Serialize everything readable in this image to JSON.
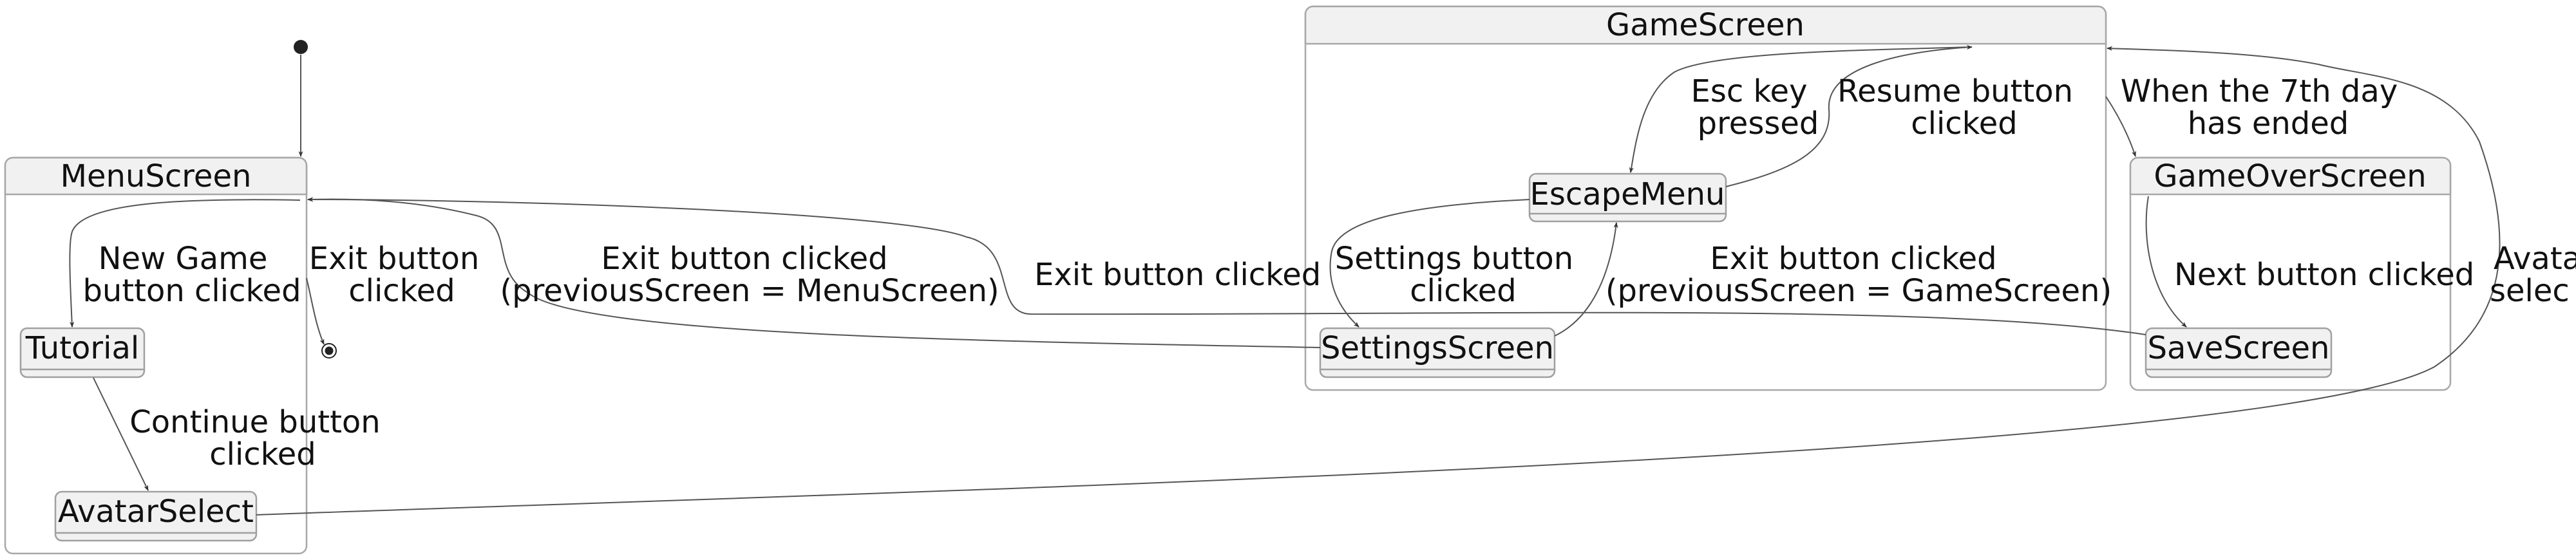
{
  "diagram": {
    "type": "state-diagram",
    "composite_states": {
      "menu": "MenuScreen",
      "game": "GameScreen",
      "gameover": "GameOverScreen"
    },
    "states": {
      "tutorial": "Tutorial",
      "avatar_select": "AvatarSelect",
      "escape_menu": "EscapeMenu",
      "settings": "SettingsScreen",
      "save": "SaveScreen"
    },
    "transitions": {
      "new_game": [
        "New Game",
        "button clicked"
      ],
      "exit_menu": [
        "Exit button",
        "clicked"
      ],
      "continue": [
        "Continue button",
        "clicked"
      ],
      "exit_settings_menu": [
        "Exit button clicked",
        "(previousScreen = MenuScreen)"
      ],
      "exit_save": [
        "Exit button clicked"
      ],
      "esc_key": [
        "Esc key",
        "pressed"
      ],
      "resume": [
        "Resume button",
        "clicked"
      ],
      "settings_btn": [
        "Settings button",
        "clicked"
      ],
      "exit_settings_game": [
        "Exit button clicked",
        "(previousScreen = GameScreen)"
      ],
      "day_ended": [
        "When the 7th day",
        "has ended"
      ],
      "next_btn": [
        "Next button clicked"
      ],
      "avatar_cut": [
        "Avata",
        "selec"
      ]
    }
  }
}
